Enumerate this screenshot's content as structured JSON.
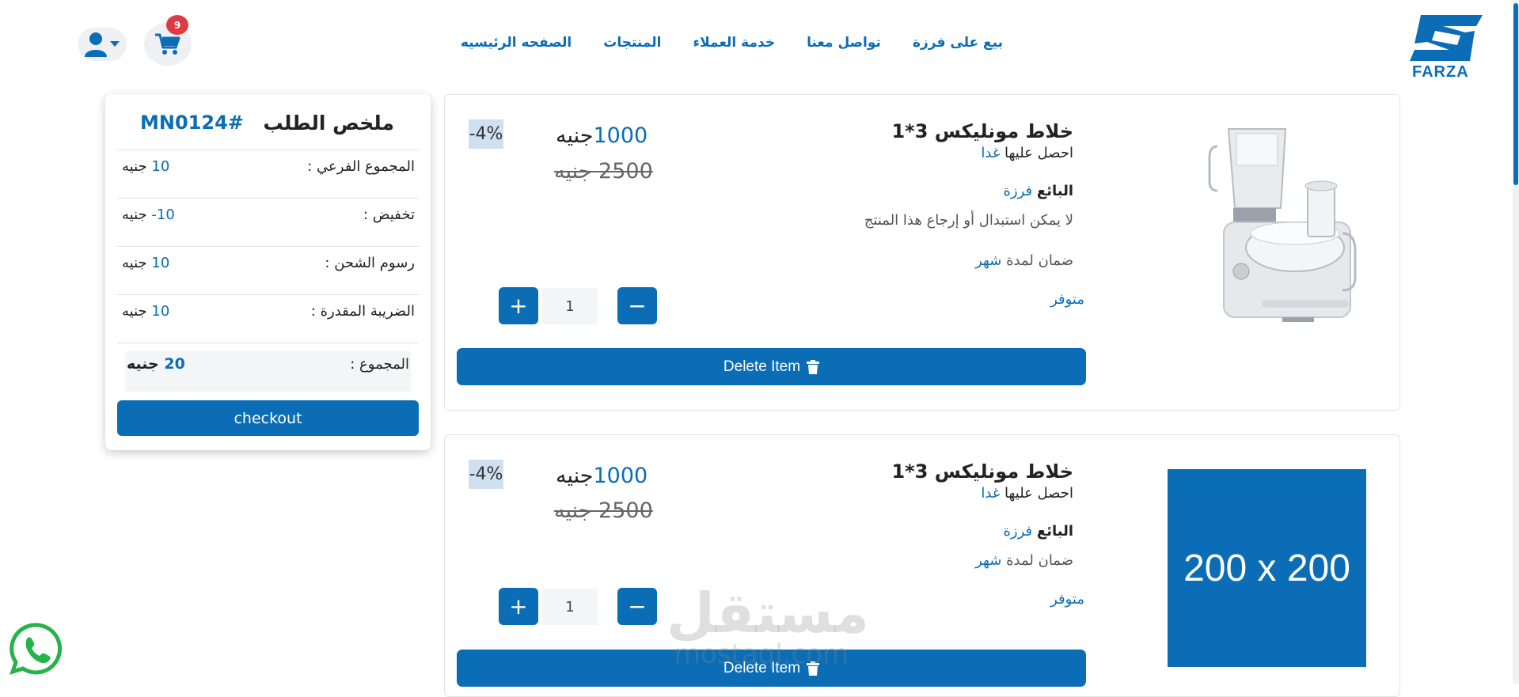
{
  "brand": {
    "name": "FARZA",
    "color": "#0a6db5"
  },
  "nav": [
    {
      "label": "الصفحه الرئيسيه"
    },
    {
      "label": "المنتجات"
    },
    {
      "label": "خدمة العملاء"
    },
    {
      "label": "تواصل معنا"
    },
    {
      "label": "بيع على فرزة"
    }
  ],
  "header": {
    "cart_count": "9",
    "cart_icon": "cart-icon",
    "user_icon": "user-icon"
  },
  "summary": {
    "title": "ملخص الطلب",
    "order_id": "MN0124#",
    "rows": [
      {
        "label": "المجموع الفرعي :",
        "amount": "10",
        "currency": "جنيه"
      },
      {
        "label": "تخفيض :",
        "amount": "10-",
        "currency": "جنيه"
      },
      {
        "label": "رسوم الشحن :",
        "amount": "10",
        "currency": "جنيه"
      },
      {
        "label": "الضريبة المقدرة :",
        "amount": "10",
        "currency": "جنيه"
      }
    ],
    "total": {
      "label": "المجموع :",
      "amount": "20",
      "currency": "جنيه"
    },
    "checkout_label": "checkout"
  },
  "products": [
    {
      "name": "خلاط مونليكس 3*1",
      "delivery_prefix": "احصل عليها",
      "delivery_value": "غدا",
      "seller_label": "البائع",
      "seller_value": "فرزة",
      "return_note": "لا يمكن استبدال أو إرجاع هذا المنتج",
      "warranty_prefix": "ضمان لمدة",
      "warranty_value": "شهر",
      "stock": "متوفر",
      "price_new_amount": "1000",
      "price_new_currency": "جنيه",
      "price_old": "2500 جنيه",
      "discount": "-4%",
      "quantity": "1",
      "delete_label": "Delete Item",
      "image": "blender-photo"
    },
    {
      "name": "خلاط مونليكس 3*1",
      "delivery_prefix": "احصل عليها",
      "delivery_value": "غدا",
      "seller_label": "البائع",
      "seller_value": "فرزة",
      "warranty_prefix": "ضمان لمدة",
      "warranty_value": "شهر",
      "stock": "متوفر",
      "price_new_amount": "1000",
      "price_new_currency": "جنيه",
      "price_old": "2500 جنيه",
      "discount": "-4%",
      "quantity": "1",
      "delete_label": "Delete Item",
      "image_placeholder": "200 x 200"
    }
  ],
  "watermark": {
    "line1": "مستقل",
    "line2": "mostaql.com"
  }
}
